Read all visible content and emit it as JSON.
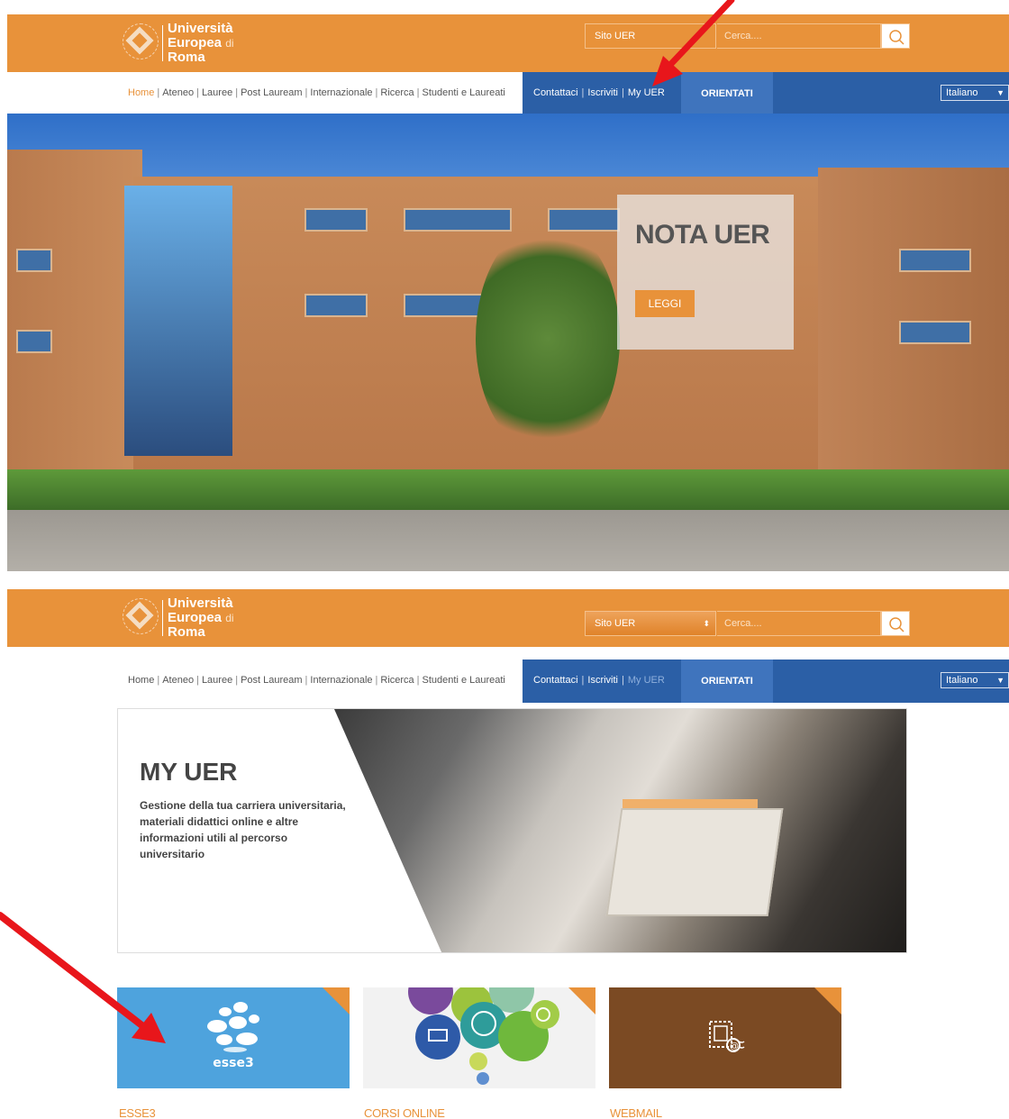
{
  "brand": {
    "line1": "Università",
    "line2": "Europea",
    "line2_small": "di",
    "line3": "Roma"
  },
  "header": {
    "site_select_1": "Sito UER",
    "site_select_2": "Sito UER",
    "search_placeholder": "Cerca....",
    "icons": {
      "search": "search-icon"
    }
  },
  "nav": {
    "items": [
      "Home",
      "Ateneo",
      "Lauree",
      "Post Lauream",
      "Internazionale",
      "Ricerca",
      "Studenti e Laureati"
    ],
    "secondary": [
      "Contattaci",
      "Iscriviti",
      "My UER"
    ],
    "orientati": "ORIENTATI",
    "language": "Italiano"
  },
  "hero": {
    "title": "NOTA UER",
    "button": "LEGGI"
  },
  "myuer": {
    "title": "MY UER",
    "description": "Gestione della tua carriera universitaria, materiali didattici online e altre informazioni utili al percorso universitario"
  },
  "tiles": [
    {
      "label": "ESSE3",
      "logo_text": "esse3"
    },
    {
      "label": "CORSI ONLINE"
    },
    {
      "label": "WEBMAIL"
    }
  ],
  "colors": {
    "orange": "#e8923a",
    "blue": "#2b5fa6",
    "blue_light": "#3f74bd",
    "esse3_blue": "#4ea3dd",
    "webmail_brown": "#7b4a23",
    "arrow_red": "#e8161b"
  }
}
